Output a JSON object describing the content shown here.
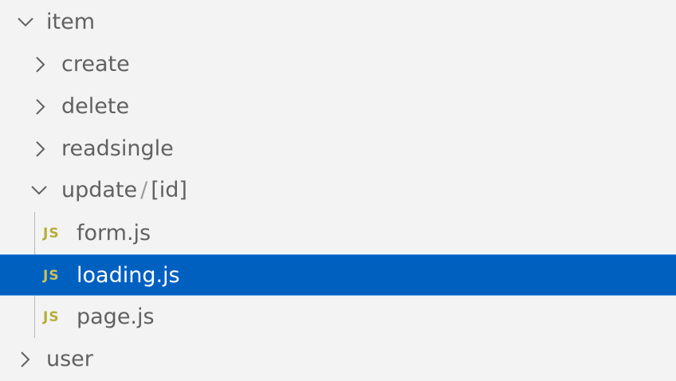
{
  "explorer": {
    "item": {
      "label": "item"
    },
    "create": {
      "label": "create"
    },
    "delete": {
      "label": "delete"
    },
    "readsingle": {
      "label": "readsingle"
    },
    "update": {
      "label": "update",
      "separator": "/",
      "sub_label": "[id]"
    },
    "files": [
      {
        "icon": "JS",
        "label": "form.js"
      },
      {
        "icon": "JS",
        "label": "loading.js"
      },
      {
        "icon": "JS",
        "label": "page.js"
      }
    ],
    "user": {
      "label": "user"
    },
    "selected_item": "loading.js"
  },
  "colors": {
    "background": "#f3f3f3",
    "selected_background": "#0060c0",
    "selected_border": "#4e9ae8",
    "text": "#616161",
    "selected_text": "#ffffff",
    "js_icon": "#b6ad3a"
  }
}
